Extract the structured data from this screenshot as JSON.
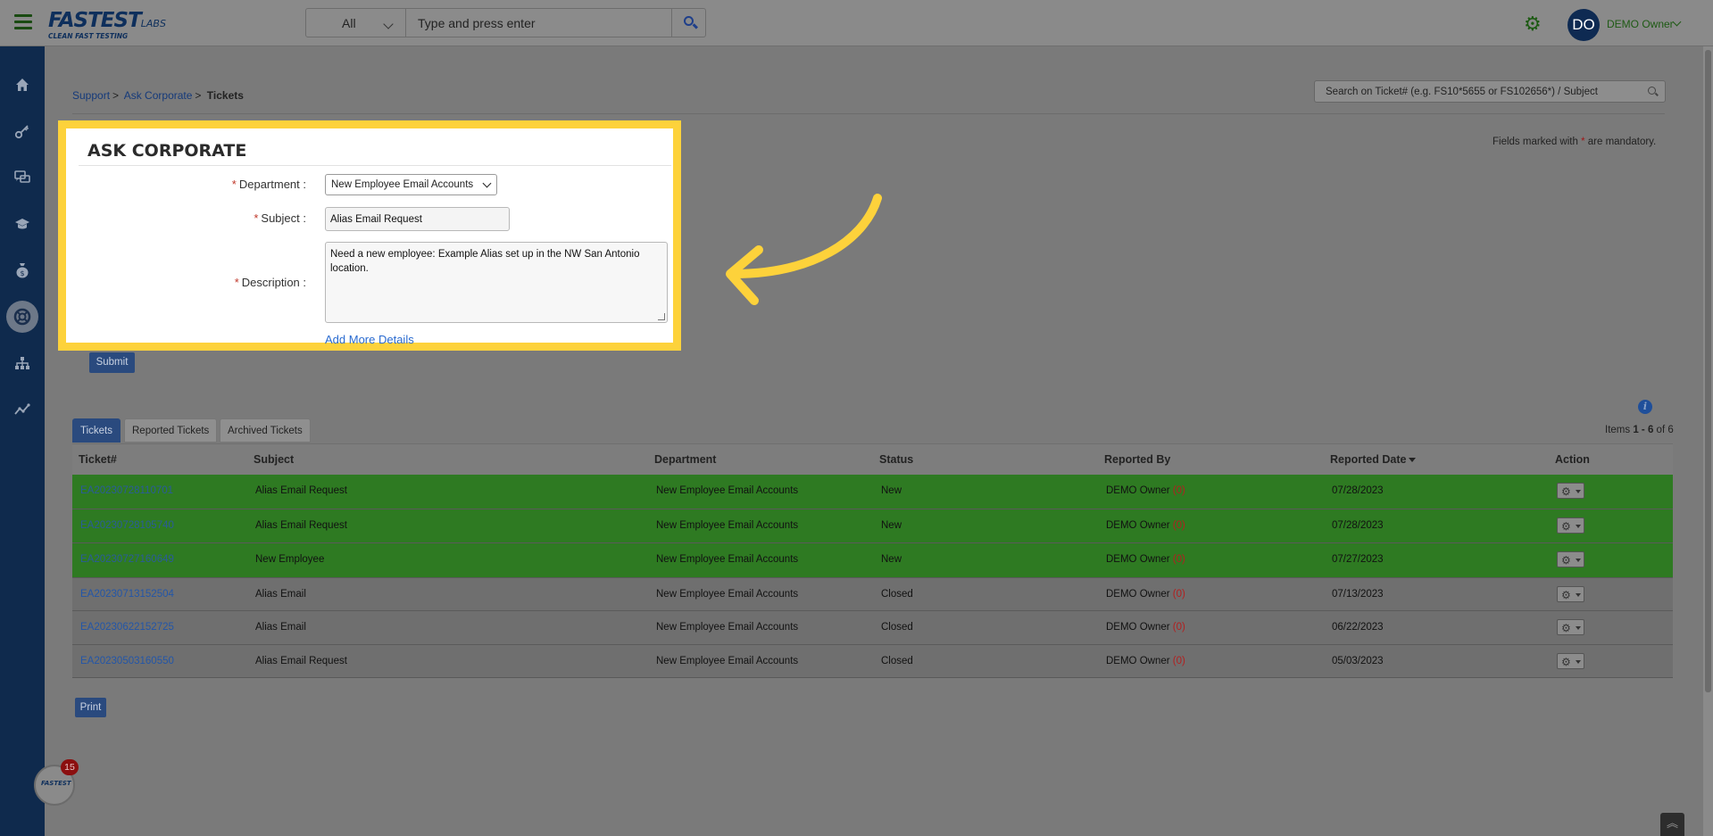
{
  "header": {
    "logo_word": "FASTEST",
    "logo_labs": "LABS",
    "logo_tagline": "CLEAN FAST TESTING",
    "search_scope": "All",
    "search_placeholder": "Type and press enter",
    "avatar_initials": "DO",
    "user_name": "DEMO Owner"
  },
  "sidebar": {
    "items": [
      {
        "icon": "home-icon"
      },
      {
        "icon": "key-icon"
      },
      {
        "icon": "chat-icon"
      },
      {
        "icon": "graduation-cap-icon"
      },
      {
        "icon": "money-bag-icon"
      },
      {
        "icon": "support-lifebuoy-icon",
        "active": true
      },
      {
        "icon": "org-chart-icon"
      },
      {
        "icon": "analytics-icon"
      }
    ]
  },
  "breadcrumb": {
    "support": "Support",
    "ask_corporate": "Ask Corporate",
    "current": "Tickets"
  },
  "ticket_search_placeholder": "Search on Ticket# (e.g. FS10*5655 or FS102656*) / Subject",
  "mandatory_note": {
    "prefix": "Fields marked with",
    "star": "*",
    "suffix": "are mandatory."
  },
  "form": {
    "title": "ASK CORPORATE",
    "department_label": "Department :",
    "department_value": "New Employee Email Accounts",
    "subject_label": "Subject :",
    "subject_value": "Alias Email Request",
    "description_label": "Description :",
    "description_value": "Need a new employee: Example Alias set up in the NW San Antonio location.",
    "add_more": "Add More Details",
    "required_mark": "*",
    "submit": "Submit"
  },
  "highlight_color": "#fdd23b",
  "tabs": [
    {
      "label": "Tickets",
      "active": true
    },
    {
      "label": "Reported Tickets",
      "active": false
    },
    {
      "label": "Archived Tickets",
      "active": false
    }
  ],
  "items_count": {
    "prefix": "Items",
    "range": "1 - 6",
    "suffix": "of 6"
  },
  "table": {
    "columns": [
      "Ticket#",
      "Subject",
      "Department",
      "Status",
      "Reported By",
      "Reported Date",
      "Action"
    ],
    "rows": [
      {
        "ticket": "EA20230728110701",
        "subject": "Alias Email Request",
        "department": "New Employee Email Accounts",
        "status": "New",
        "reported_by": "DEMO Owner",
        "reported_count": "(0)",
        "date": "07/28/2023",
        "style": "green"
      },
      {
        "ticket": "EA20230728105740",
        "subject": "Alias Email Request",
        "department": "New Employee Email Accounts",
        "status": "New",
        "reported_by": "DEMO Owner",
        "reported_count": "(0)",
        "date": "07/28/2023",
        "style": "green"
      },
      {
        "ticket": "EA20230727160649",
        "subject": "New Employee",
        "department": "New Employee Email Accounts",
        "status": "New",
        "reported_by": "DEMO Owner",
        "reported_count": "(0)",
        "date": "07/27/2023",
        "style": "green"
      },
      {
        "ticket": "EA20230713152504",
        "subject": "Alias Email",
        "department": "New Employee Email Accounts",
        "status": "Closed",
        "reported_by": "DEMO Owner",
        "reported_count": "(0)",
        "date": "07/13/2023",
        "style": "grey"
      },
      {
        "ticket": "EA20230622152725",
        "subject": "Alias Email",
        "department": "New Employee Email Accounts",
        "status": "Closed",
        "reported_by": "DEMO Owner",
        "reported_count": "(0)",
        "date": "06/22/2023",
        "style": "grey"
      },
      {
        "ticket": "EA20230503160550",
        "subject": "Alias Email Request",
        "department": "New Employee Email Accounts",
        "status": "Closed",
        "reported_by": "DEMO Owner",
        "reported_count": "(0)",
        "date": "05/03/2023",
        "style": "grey"
      }
    ]
  },
  "print_label": "Print",
  "chat_badge": "15"
}
